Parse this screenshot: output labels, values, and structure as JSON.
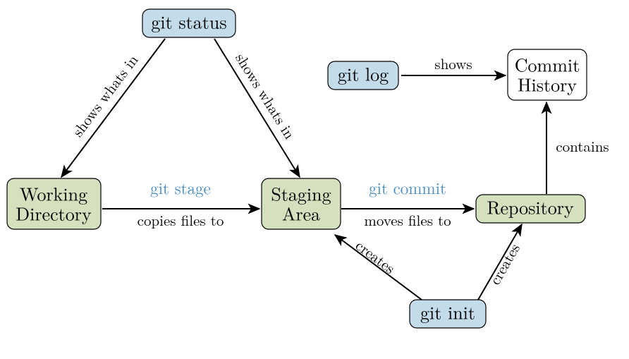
{
  "nodes": {
    "git_status": {
      "label": "git status"
    },
    "working_directory": {
      "line1": "Working",
      "line2": "Directory"
    },
    "staging_area": {
      "line1": "Staging",
      "line2": "Area"
    },
    "repository": {
      "label": "Repository"
    },
    "git_init": {
      "label": "git init"
    },
    "git_log": {
      "label": "git log"
    },
    "commit_history": {
      "line1": "Commit",
      "line2": "History"
    }
  },
  "edges": {
    "status_to_wd": {
      "label": "shows whats in"
    },
    "status_to_sa": {
      "label": "shows whats in"
    },
    "wd_to_sa": {
      "cmd": "git stage",
      "label": "copies files to"
    },
    "sa_to_repo": {
      "cmd": "git commit",
      "label": "moves files to"
    },
    "init_to_sa": {
      "label": "creates"
    },
    "init_to_repo": {
      "label": "creates"
    },
    "log_to_ch": {
      "label": "shows"
    },
    "repo_to_ch": {
      "label": "contains"
    }
  }
}
